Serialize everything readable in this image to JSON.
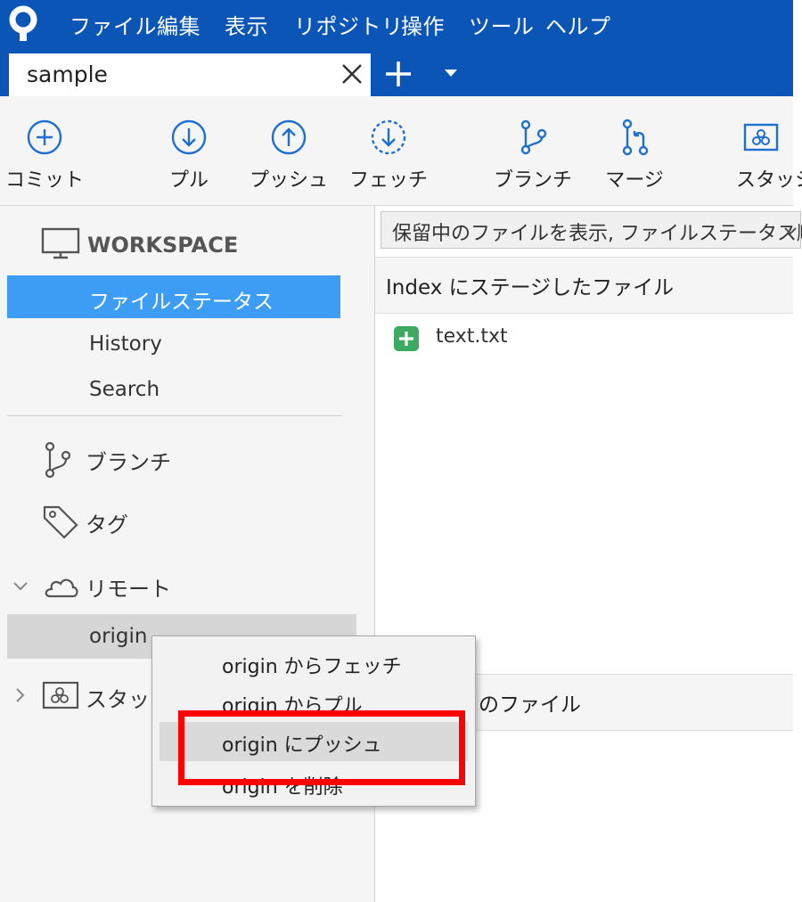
{
  "menu": [
    "ファイル",
    "編集",
    "表示",
    "リポジトリ",
    "操作",
    "ツール",
    "ヘルプ"
  ],
  "tab": {
    "title": "sample"
  },
  "toolbar": {
    "commit": "コミット",
    "pull": "プル",
    "push": "プッシュ",
    "fetch": "フェッチ",
    "branch": "ブランチ",
    "merge": "マージ",
    "stash": "スタッシ"
  },
  "sidebar": {
    "workspace": "WORKSPACE",
    "file_status": "ファイルステータス",
    "history": "History",
    "search": "Search",
    "branches": "ブランチ",
    "tags": "タグ",
    "remotes": "リモート",
    "origin": "origin",
    "stashes": "スタッシ"
  },
  "main": {
    "filter": "保留中のファイルを表示, ファイルステータス順",
    "staged_header": "Index にステージしたファイル",
    "staged_files": [
      "text.txt"
    ],
    "unstaged_header": "のファイル"
  },
  "context_menu": {
    "items": [
      "origin からフェッチ",
      "origin からプル",
      "origin にプッシュ",
      "origin を削除"
    ],
    "hover_index": 2
  },
  "colors": {
    "title_bar": "#0b55b7",
    "icon_blue": "#1f6fd1",
    "selection": "#3d9df4",
    "added_green": "#3daa62",
    "highlight_red": "#ff0000"
  }
}
